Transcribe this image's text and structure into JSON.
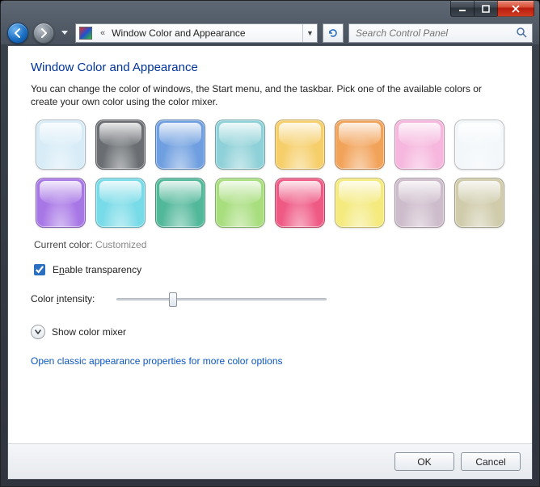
{
  "breadcrumb": {
    "label": "Window Color and Appearance"
  },
  "search": {
    "placeholder": "Search Control Panel"
  },
  "page": {
    "title": "Window Color and Appearance",
    "description": "You can change the color of windows, the Start menu, and the taskbar. Pick one of the available colors or create your own color using the color mixer."
  },
  "colors": [
    {
      "name": "sky",
      "hex": "#d8ecf7"
    },
    {
      "name": "graphite",
      "hex": "#6a6e72"
    },
    {
      "name": "blue",
      "hex": "#6f9fe0"
    },
    {
      "name": "teal",
      "hex": "#8fd1d8"
    },
    {
      "name": "sun",
      "hex": "#f6cf6a"
    },
    {
      "name": "pumpkin",
      "hex": "#f2a35a"
    },
    {
      "name": "blush",
      "hex": "#f6b6dd"
    },
    {
      "name": "frost",
      "hex": "#f3f7fa"
    },
    {
      "name": "violet",
      "hex": "#a877e6"
    },
    {
      "name": "aqua",
      "hex": "#78dbe8"
    },
    {
      "name": "emerald",
      "hex": "#52b89a"
    },
    {
      "name": "lime",
      "hex": "#a8de7e"
    },
    {
      "name": "rose",
      "hex": "#ef5a85"
    },
    {
      "name": "lemon",
      "hex": "#f4ea7e"
    },
    {
      "name": "lavender",
      "hex": "#cdbccb"
    },
    {
      "name": "taupe",
      "hex": "#cfcbab"
    }
  ],
  "current_color": {
    "label": "Current color:",
    "value": "Customized"
  },
  "transparency": {
    "label_pre": "E",
    "label_u": "n",
    "label_post": "able transparency",
    "checked": true
  },
  "intensity": {
    "label_pre": "Color ",
    "label_u": "i",
    "label_post": "ntensity:",
    "percent": 26
  },
  "mixer": {
    "label": "Show color mixer"
  },
  "classic_link": "Open classic appearance properties for more color options",
  "buttons": {
    "ok": "OK",
    "cancel": "Cancel"
  }
}
